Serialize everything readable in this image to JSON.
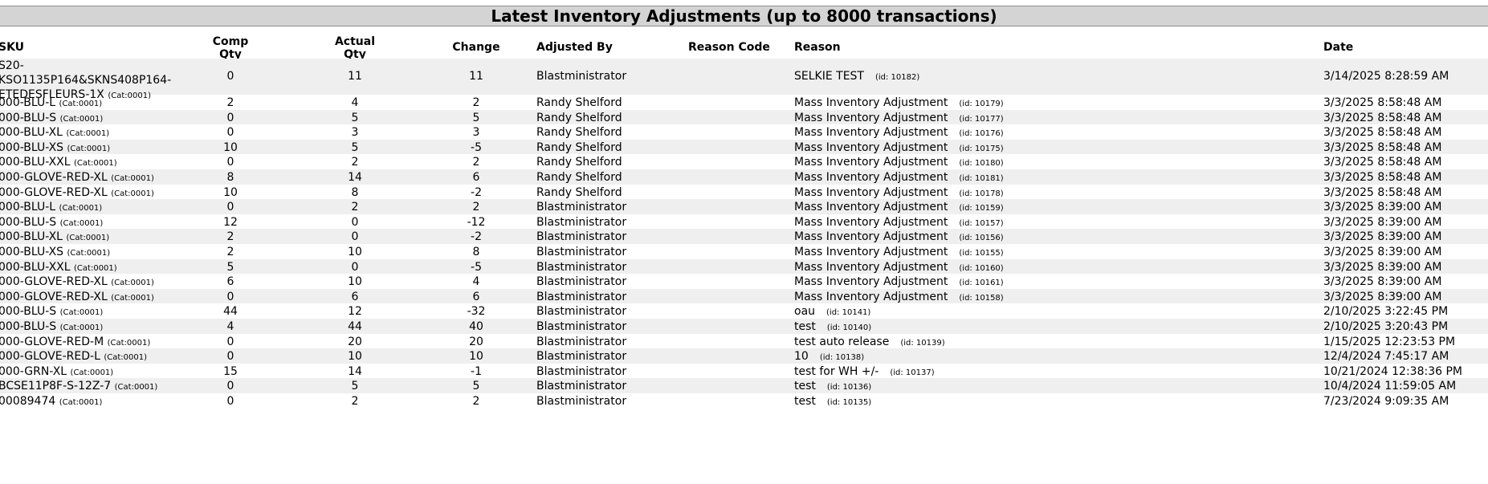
{
  "title": "Latest Inventory Adjustments (up to 8000 transactions)",
  "headers": {
    "sku": "SKU",
    "comp_qty_1": "Comp",
    "comp_qty_2": "Qty",
    "actual_qty_1": "Actual",
    "actual_qty_2": "Qty",
    "change": "Change",
    "adjusted_by": "Adjusted By",
    "reason_code": "Reason Code",
    "reason": "Reason",
    "date": "Date"
  },
  "rows": [
    {
      "sku_lines": [
        "S20-",
        "KSO1135P164&SKNS408P164-",
        "ETEDESFLEURS-1X"
      ],
      "cat": "(Cat:0001)",
      "comp": "0",
      "actual": "11",
      "change": "11",
      "by": "Blastministrator",
      "code": "",
      "reason": "SELKIE TEST",
      "rid": "(id: 10182)",
      "date": "3/14/2025 8:28:59 AM"
    },
    {
      "sku": "000-BLU-L",
      "cat": "(Cat:0001)",
      "comp": "2",
      "actual": "4",
      "change": "2",
      "by": "Randy Shelford",
      "code": "",
      "reason": "Mass Inventory Adjustment",
      "rid": "(id: 10179)",
      "date": "3/3/2025 8:58:48 AM"
    },
    {
      "sku": "000-BLU-S",
      "cat": "(Cat:0001)",
      "comp": "0",
      "actual": "5",
      "change": "5",
      "by": "Randy Shelford",
      "code": "",
      "reason": "Mass Inventory Adjustment",
      "rid": "(id: 10177)",
      "date": "3/3/2025 8:58:48 AM"
    },
    {
      "sku": "000-BLU-XL",
      "cat": "(Cat:0001)",
      "comp": "0",
      "actual": "3",
      "change": "3",
      "by": "Randy Shelford",
      "code": "",
      "reason": "Mass Inventory Adjustment",
      "rid": "(id: 10176)",
      "date": "3/3/2025 8:58:48 AM"
    },
    {
      "sku": "000-BLU-XS",
      "cat": "(Cat:0001)",
      "comp": "10",
      "actual": "5",
      "change": "-5",
      "by": "Randy Shelford",
      "code": "",
      "reason": "Mass Inventory Adjustment",
      "rid": "(id: 10175)",
      "date": "3/3/2025 8:58:48 AM"
    },
    {
      "sku": "000-BLU-XXL",
      "cat": "(Cat:0001)",
      "comp": "0",
      "actual": "2",
      "change": "2",
      "by": "Randy Shelford",
      "code": "",
      "reason": "Mass Inventory Adjustment",
      "rid": "(id: 10180)",
      "date": "3/3/2025 8:58:48 AM"
    },
    {
      "sku": "000-GLOVE-RED-XL",
      "cat": "(Cat:0001)",
      "comp": "8",
      "actual": "14",
      "change": "6",
      "by": "Randy Shelford",
      "code": "",
      "reason": "Mass Inventory Adjustment",
      "rid": "(id: 10181)",
      "date": "3/3/2025 8:58:48 AM"
    },
    {
      "sku": "000-GLOVE-RED-XL",
      "cat": "(Cat:0001)",
      "comp": "10",
      "actual": "8",
      "change": "-2",
      "by": "Randy Shelford",
      "code": "",
      "reason": "Mass Inventory Adjustment",
      "rid": "(id: 10178)",
      "date": "3/3/2025 8:58:48 AM"
    },
    {
      "sku": "000-BLU-L",
      "cat": "(Cat:0001)",
      "comp": "0",
      "actual": "2",
      "change": "2",
      "by": "Blastministrator",
      "code": "",
      "reason": "Mass Inventory Adjustment",
      "rid": "(id: 10159)",
      "date": "3/3/2025 8:39:00 AM"
    },
    {
      "sku": "000-BLU-S",
      "cat": "(Cat:0001)",
      "comp": "12",
      "actual": "0",
      "change": "-12",
      "by": "Blastministrator",
      "code": "",
      "reason": "Mass Inventory Adjustment",
      "rid": "(id: 10157)",
      "date": "3/3/2025 8:39:00 AM"
    },
    {
      "sku": "000-BLU-XL",
      "cat": "(Cat:0001)",
      "comp": "2",
      "actual": "0",
      "change": "-2",
      "by": "Blastministrator",
      "code": "",
      "reason": "Mass Inventory Adjustment",
      "rid": "(id: 10156)",
      "date": "3/3/2025 8:39:00 AM"
    },
    {
      "sku": "000-BLU-XS",
      "cat": "(Cat:0001)",
      "comp": "2",
      "actual": "10",
      "change": "8",
      "by": "Blastministrator",
      "code": "",
      "reason": "Mass Inventory Adjustment",
      "rid": "(id: 10155)",
      "date": "3/3/2025 8:39:00 AM"
    },
    {
      "sku": "000-BLU-XXL",
      "cat": "(Cat:0001)",
      "comp": "5",
      "actual": "0",
      "change": "-5",
      "by": "Blastministrator",
      "code": "",
      "reason": "Mass Inventory Adjustment",
      "rid": "(id: 10160)",
      "date": "3/3/2025 8:39:00 AM"
    },
    {
      "sku": "000-GLOVE-RED-XL",
      "cat": "(Cat:0001)",
      "comp": "6",
      "actual": "10",
      "change": "4",
      "by": "Blastministrator",
      "code": "",
      "reason": "Mass Inventory Adjustment",
      "rid": "(id: 10161)",
      "date": "3/3/2025 8:39:00 AM"
    },
    {
      "sku": "000-GLOVE-RED-XL",
      "cat": "(Cat:0001)",
      "comp": "0",
      "actual": "6",
      "change": "6",
      "by": "Blastministrator",
      "code": "",
      "reason": "Mass Inventory Adjustment",
      "rid": "(id: 10158)",
      "date": "3/3/2025 8:39:00 AM"
    },
    {
      "sku": "000-BLU-S",
      "cat": "(Cat:0001)",
      "comp": "44",
      "actual": "12",
      "change": "-32",
      "by": "Blastministrator",
      "code": "",
      "reason": "oau",
      "rid": "(id: 10141)",
      "date": "2/10/2025 3:22:45 PM"
    },
    {
      "sku": "000-BLU-S",
      "cat": "(Cat:0001)",
      "comp": "4",
      "actual": "44",
      "change": "40",
      "by": "Blastministrator",
      "code": "",
      "reason": "test",
      "rid": "(id: 10140)",
      "date": "2/10/2025 3:20:43 PM"
    },
    {
      "sku": "000-GLOVE-RED-M",
      "cat": "(Cat:0001)",
      "comp": "0",
      "actual": "20",
      "change": "20",
      "by": "Blastministrator",
      "code": "",
      "reason": "test auto release",
      "rid": "(id: 10139)",
      "date": "1/15/2025 12:23:53 PM"
    },
    {
      "sku": "000-GLOVE-RED-L",
      "cat": "(Cat:0001)",
      "comp": "0",
      "actual": "10",
      "change": "10",
      "by": "Blastministrator",
      "code": "",
      "reason": "10",
      "rid": "(id: 10138)",
      "date": "12/4/2024 7:45:17 AM"
    },
    {
      "sku": "000-GRN-XL",
      "cat": "(Cat:0001)",
      "comp": "15",
      "actual": "14",
      "change": "-1",
      "by": "Blastministrator",
      "code": "",
      "reason": "test for WH +/-",
      "rid": "(id: 10137)",
      "date": "10/21/2024 12:38:36 PM"
    },
    {
      "sku": "BCSE11P8F-S-12Z-7",
      "cat": "(Cat:0001)",
      "comp": "0",
      "actual": "5",
      "change": "5",
      "by": "Blastministrator",
      "code": "",
      "reason": "test",
      "rid": "(id: 10136)",
      "date": "10/4/2024 11:59:05 AM"
    },
    {
      "sku": "00089474",
      "cat": "(Cat:0001)",
      "comp": "0",
      "actual": "2",
      "change": "2",
      "by": "Blastministrator",
      "code": "",
      "reason": "test",
      "rid": "(id: 10135)",
      "date": "7/23/2024 9:09:35 AM"
    }
  ]
}
